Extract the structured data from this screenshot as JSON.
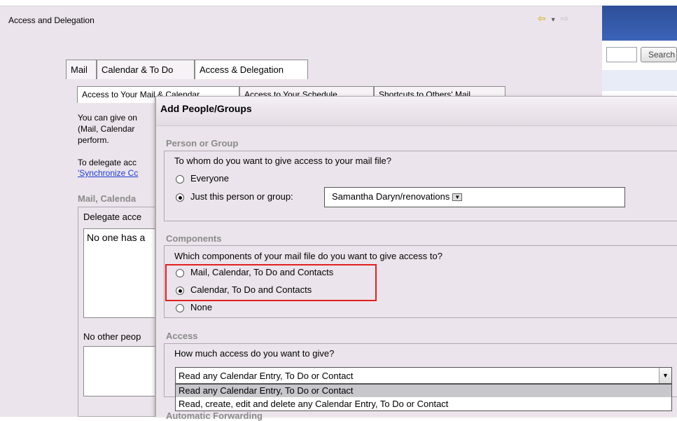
{
  "window": {
    "title": "Access and Delegation",
    "nav": {
      "back": "⇦",
      "menu": "▾",
      "forward": "⇨"
    }
  },
  "right_pane": {
    "search_button": "Search"
  },
  "tabs": [
    {
      "label": "Mail"
    },
    {
      "label": "Calendar & To Do"
    },
    {
      "label": "Access & Delegation"
    }
  ],
  "subtabs": [
    {
      "label": "Access to Your Mail & Calendar"
    },
    {
      "label": "Access to Your Schedule"
    },
    {
      "label": "Shortcuts to Others' Mail"
    }
  ],
  "background": {
    "text1": "You can give on (Mail, Calendar perform.",
    "text2": "To delegate acc",
    "link": "'Synchronize Cc",
    "section": "Mail, Calenda",
    "delegate_label": "Delegate acce",
    "list1_text": "No one has a",
    "other_label": "No other peop"
  },
  "dialog": {
    "title": "Add People/Groups",
    "person_group": {
      "heading": "Person or Group",
      "question": "To whom do you want to give access to your mail file?",
      "options": [
        {
          "label": "Everyone",
          "selected": false
        },
        {
          "label": "Just this person or group:",
          "selected": true
        }
      ],
      "value": "Samantha Daryn/renovations"
    },
    "components": {
      "heading": "Components",
      "question": "Which components of your mail file do you want to give access to?",
      "options": [
        {
          "label": "Mail, Calendar, To Do and Contacts",
          "selected": false
        },
        {
          "label": "Calendar, To Do and Contacts",
          "selected": true
        },
        {
          "label": "None",
          "selected": false
        }
      ]
    },
    "access": {
      "heading": "Access",
      "question": "How much access do you want to give?",
      "selected": "Read any Calendar Entry, To Do or Contact",
      "options": [
        "Read any Calendar Entry, To Do or Contact",
        "Read, create, edit and delete any Calendar Entry, To Do or Contact"
      ]
    },
    "next_heading": "Automatic Forwarding"
  },
  "colors": {
    "highlight": "#e02020",
    "link": "#1a3dd0",
    "header_blue": "#2e4f98"
  }
}
